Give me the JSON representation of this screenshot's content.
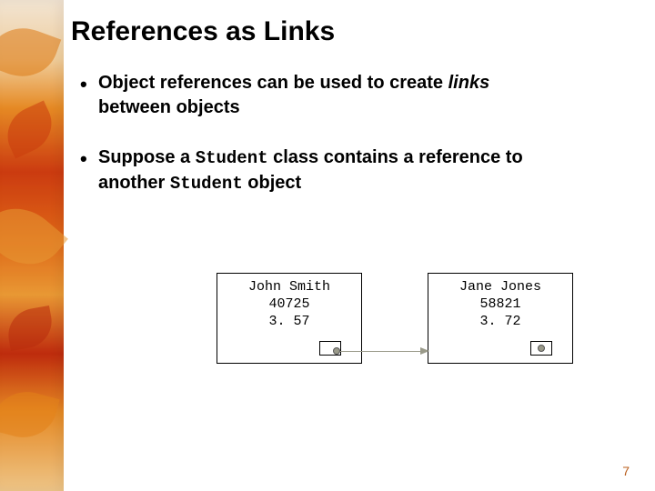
{
  "title": "References as Links",
  "bullets": [
    {
      "pre": "Object references can be used to create ",
      "em": "links",
      "tail_pre_br": "",
      "tail": "between objects"
    },
    {
      "pre": "Suppose a ",
      "code1": "Student",
      "mid": " class contains a reference to",
      "tail_code": "Student",
      "tail_after": " object"
    }
  ],
  "objects": {
    "left": {
      "name": "John Smith",
      "id": "40725",
      "gpa": "3. 57"
    },
    "right": {
      "name": "Jane Jones",
      "id": "58821",
      "gpa": "3. 72"
    }
  },
  "another_word": "another ",
  "slide_number": "7"
}
